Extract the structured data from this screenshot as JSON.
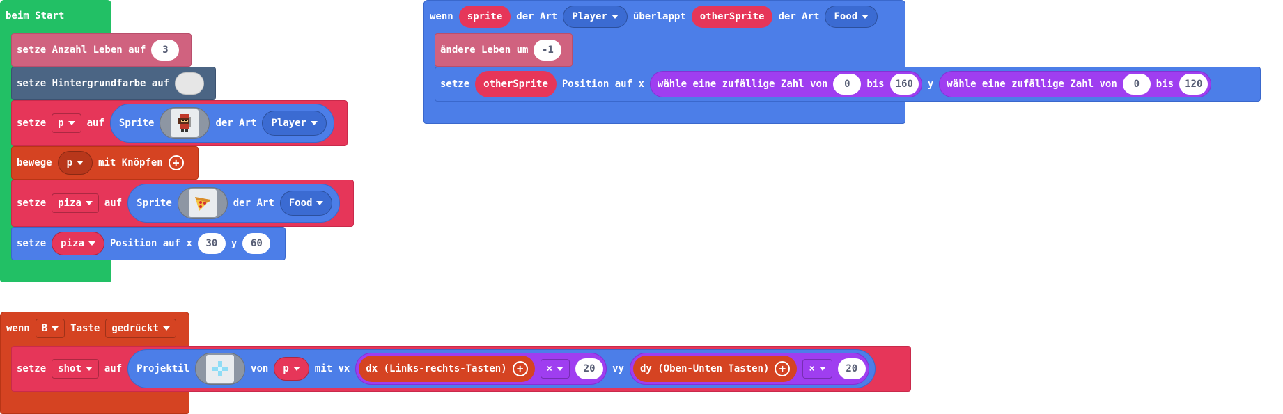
{
  "colors": {
    "events_green": "#22c065",
    "info_pink": "#d0627f",
    "scene_slate": "#4b6584",
    "sprites_blue": "#4c7ee8",
    "sprites_red": "#e63659",
    "controller_orange": "#d54322",
    "math_purple": "#9f3ef0"
  },
  "on_start": {
    "hat_label": "beim Start",
    "set_life": {
      "label": "setze Anzahl Leben auf",
      "value": "3"
    },
    "set_background": {
      "label": "setze Hintergrundfarbe auf"
    },
    "create_p": {
      "set_label": "setze",
      "var": "p",
      "to_label": "auf",
      "sprite_label": "Sprite",
      "image": "ninja-sprite-image",
      "kind_label": "der Art",
      "kind": "Player"
    },
    "move_p": {
      "label": "bewege",
      "var": "p",
      "suffix": "mit Knöpfen",
      "icon": "plus-icon"
    },
    "create_piza": {
      "set_label": "setze",
      "var": "piza",
      "to_label": "auf",
      "sprite_label": "Sprite",
      "image": "pizza-sprite-image",
      "kind_label": "der Art",
      "kind": "Food"
    },
    "set_position": {
      "set_label": "setze",
      "var": "piza",
      "pos_label": "Position auf x",
      "x": "30",
      "y_label": "y",
      "y": "60"
    }
  },
  "on_overlap": {
    "when_label": "wenn",
    "sprite_var": "sprite",
    "kind_label_1": "der Art",
    "kind_1": "Player",
    "overlaps_label": "überlappt",
    "other_var": "otherSprite",
    "kind_label_2": "der Art",
    "kind_2": "Food",
    "change_life": {
      "label": "ändere Leben um",
      "value": "-1"
    },
    "set_position": {
      "set_label": "setze",
      "var": "otherSprite",
      "pos_label": "Position auf x",
      "rand_x": {
        "label": "wähle eine zufällige Zahl von",
        "from": "0",
        "to_label": "bis",
        "to": "160"
      },
      "y_label": "y",
      "rand_y": {
        "label": "wähle eine zufällige Zahl von",
        "from": "0",
        "to_label": "bis",
        "to": "120"
      }
    }
  },
  "on_button": {
    "when_label": "wenn",
    "button": "B",
    "key_label": "Taste",
    "event": "gedrückt",
    "set_shot": {
      "set_label": "setze",
      "var": "shot",
      "to_label": "auf",
      "projectile_label": "Projektil",
      "image": "crosshair-projectile-image",
      "from_label": "von",
      "from_var": "p",
      "vx_label": "mit vx",
      "dx_label": "dx (Links-rechts-Tasten)",
      "op_1": "×",
      "vx_mult": "20",
      "vy_label": "vy",
      "dy_label": "dy (Oben-Unten Tasten)",
      "op_2": "×",
      "vy_mult": "20"
    }
  }
}
